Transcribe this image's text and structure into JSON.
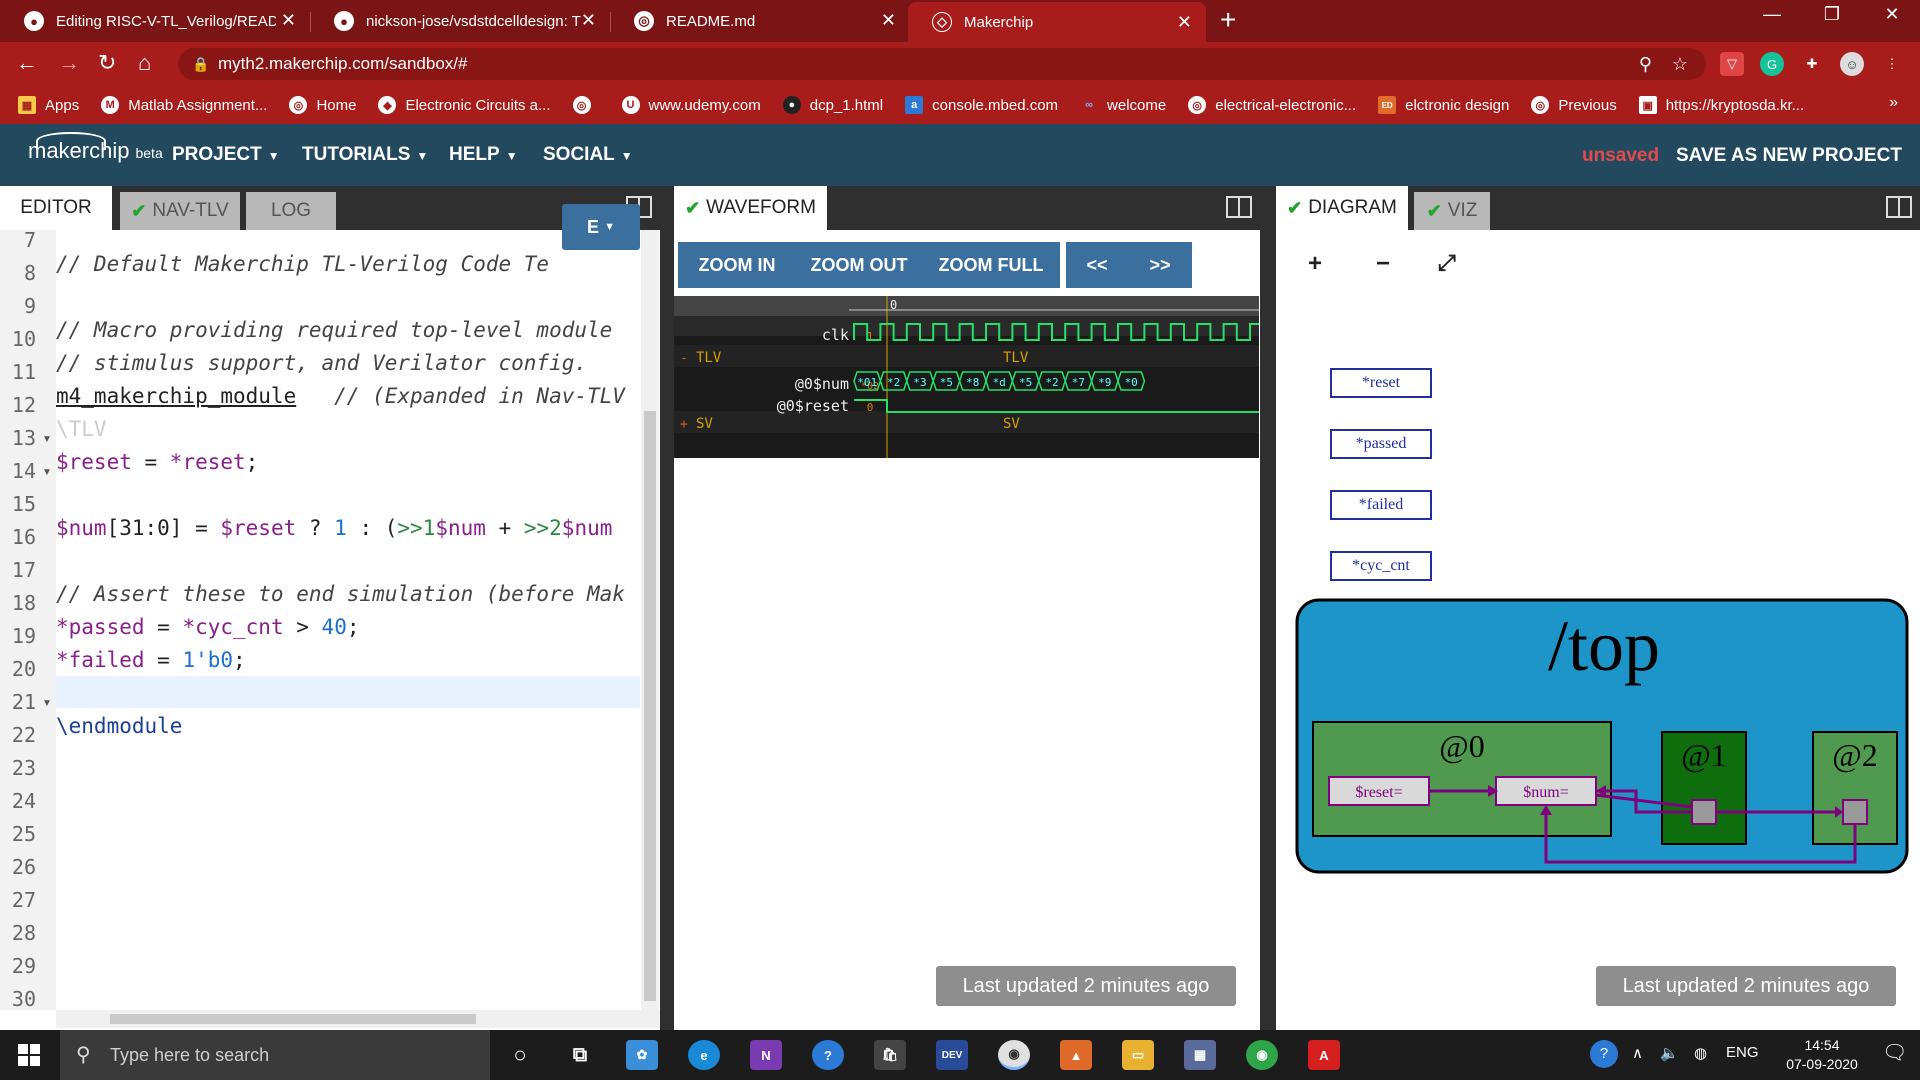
{
  "browser": {
    "tabs": [
      {
        "title": "Editing RISC-V-TL_Verilog/READM",
        "icon": "github-icon"
      },
      {
        "title": "nickson-jose/vsdstdcelldesign: Th",
        "icon": "github-icon"
      },
      {
        "title": "README.md",
        "icon": "globe-icon"
      },
      {
        "title": "Makerchip",
        "icon": "makerchip-icon"
      }
    ],
    "url": "myth2.makerchip.com/sandbox/#",
    "bookmarks": [
      "Apps",
      "Matlab Assignment...",
      "Home",
      "Electronic Circuits a...",
      "",
      "www.udemy.com",
      "dcp_1.html",
      "console.mbed.com",
      "welcome",
      "electrical-electronic...",
      "elctronic design",
      "Previous",
      "https://kryptosda.kr..."
    ],
    "bookmarks_more": "»"
  },
  "app": {
    "logo": "makerchip",
    "beta": "beta",
    "menus": [
      "PROJECT",
      "TUTORIALS",
      "HELP",
      "SOCIAL"
    ],
    "status": "unsaved",
    "save_label": "SAVE AS NEW PROJECT"
  },
  "editor": {
    "tabs": [
      "EDITOR",
      "NAV-TLV",
      "LOG"
    ],
    "view_button": "E",
    "lines": [
      {
        "n": "7"
      },
      {
        "n": "8",
        "text": "// Default Makerchip TL-Verilog Code Te"
      },
      {
        "n": "9"
      },
      {
        "n": "10",
        "text": "// Macro providing required top-level module"
      },
      {
        "n": "11",
        "text": "// stimulus support, and Verilator config."
      },
      {
        "n": "12",
        "text": "m4_makerchip_module",
        "text2": "   // (Expanded in Nav-TLV"
      },
      {
        "n": "13",
        "text": "\\TLV"
      },
      {
        "n": "14",
        "text": "$reset = *reset;"
      },
      {
        "n": "15"
      },
      {
        "n": "16",
        "text": "$num[31:0] = $reset ? 1 : (>>1$num + >>2$num"
      },
      {
        "n": "17"
      },
      {
        "n": "18",
        "text": "// Assert these to end simulation (before Mak"
      },
      {
        "n": "19",
        "text": "*passed = *cyc_cnt > 40;"
      },
      {
        "n": "20",
        "text": "*failed = 1'b0;"
      },
      {
        "n": "21"
      },
      {
        "n": "22",
        "text": "\\endmodule"
      },
      {
        "n": "23"
      },
      {
        "n": "24"
      },
      {
        "n": "25"
      },
      {
        "n": "26"
      },
      {
        "n": "27"
      },
      {
        "n": "28"
      },
      {
        "n": "29"
      },
      {
        "n": "30"
      }
    ],
    "code": {
      "l8": "// Default Makerchip TL-Verilog Code Te",
      "l10": "// Macro providing required top-level module",
      "l11": "// stimulus support, and Verilator config.",
      "l12a": "m4_makerchip_module",
      "l12b": "   // (Expanded in Nav-TLV",
      "l14a": "$reset",
      "l14b": " = ",
      "l14c": "*reset",
      "l14d": ";",
      "l16a": "$num",
      "l16b": "[31:0] = ",
      "l16c": "$reset",
      "l16d": " ? ",
      "l16e": "1",
      "l16f": " : (",
      "l16g": ">>1",
      "l16h": "$num",
      "l16i": " + ",
      "l16j": ">>2",
      "l16k": "$num",
      "l18": "// Assert these to end simulation (before Mak",
      "l19a": "*passed",
      "l19b": " = ",
      "l19c": "*cyc_cnt",
      "l19d": " > ",
      "l19e": "40",
      "l19f": ";",
      "l20a": "*failed",
      "l20b": " = ",
      "l20c": "1'b0",
      "l20d": ";",
      "l22": "\\endmodule"
    }
  },
  "waveform": {
    "tab": "WAVEFORM",
    "buttons": [
      "ZOOM IN",
      "ZOOM OUT",
      "ZOOM FULL",
      "<<",
      ">>"
    ],
    "time_zero": "0",
    "signals": {
      "clk": "clk",
      "clk_val": "1",
      "tlv": "TLV",
      "num": "@0$num",
      "num_val": "*02",
      "reset": "@0$reset",
      "reset_val": "0",
      "sv": "SV"
    },
    "num_values": [
      "*01",
      "*2",
      "*3",
      "*5",
      "*8",
      "*d",
      "*5",
      "*2",
      "*7",
      "*9",
      "*0"
    ],
    "last_updated": "Last updated 2 minutes ago"
  },
  "diagram": {
    "tabs": [
      "DIAGRAM",
      "VIZ"
    ],
    "controls": [
      "+",
      "−",
      "⤢"
    ],
    "signals": [
      "*reset",
      "*passed",
      "*failed",
      "*cyc_cnt"
    ],
    "scope": "/top",
    "stages": [
      "@0",
      "@1",
      "@2"
    ],
    "nodes": [
      "$reset=",
      "$num="
    ],
    "last_updated": "Last updated 2 minutes ago"
  },
  "taskbar": {
    "search_placeholder": "Type here to search",
    "lang": "ENG",
    "time": "14:54",
    "date": "07-09-2020"
  },
  "colors": {
    "chrome_dark": "#7b1414",
    "chrome": "#a81c1c",
    "makerchip_header": "#23495f",
    "button_blue": "#3a6f9e",
    "scope_blue": "#1d95c9",
    "stage_green": "#4f9a4f",
    "stage_dark_green": "#0e6e0e",
    "wave_green": "#22e06a"
  }
}
